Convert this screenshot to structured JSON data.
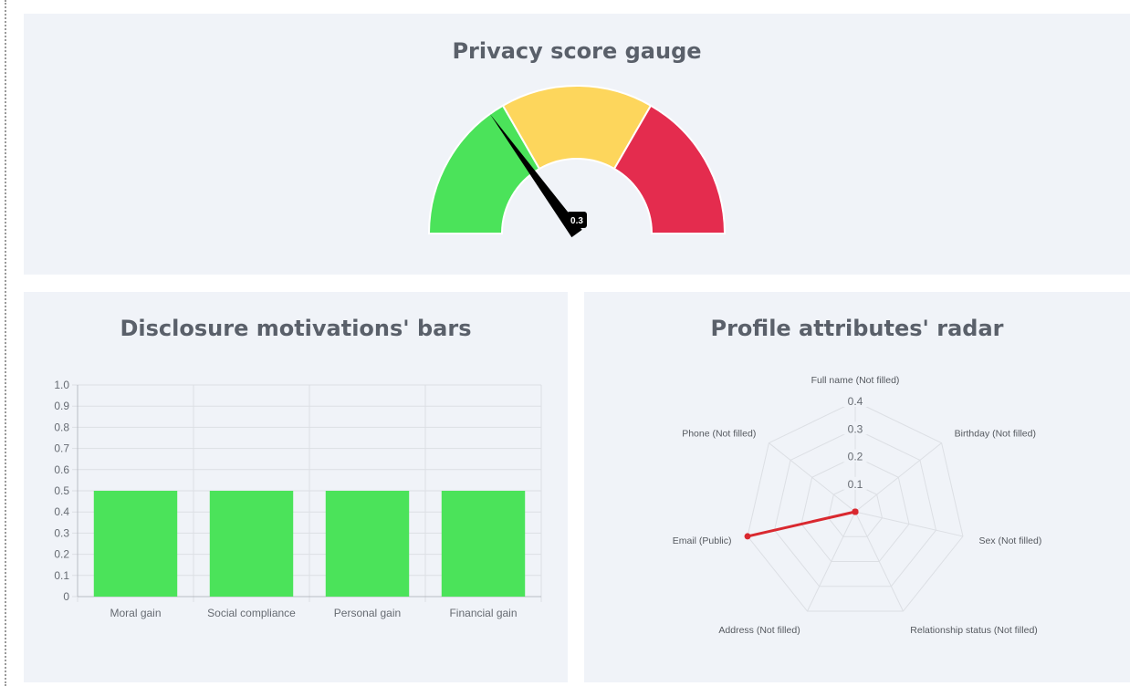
{
  "gauge": {
    "title": "Privacy score gauge",
    "value": 0.3,
    "value_label": "0.3",
    "range": [
      0,
      1
    ],
    "segments": [
      {
        "from": 0,
        "to": 0.3333,
        "color": "#4be35a"
      },
      {
        "from": 0.3333,
        "to": 0.6667,
        "color": "#fdd65c"
      },
      {
        "from": 0.6667,
        "to": 1,
        "color": "#e42c4e"
      }
    ]
  },
  "bars": {
    "title": "Disclosure motivations' bars",
    "bar_color": "#4be35a"
  },
  "radar": {
    "title": "Profile attributes' radar",
    "line_color": "#d9282f"
  },
  "chart_data": [
    {
      "type": "gauge",
      "title": "Privacy score gauge",
      "value": 0.3,
      "range": [
        0,
        1
      ],
      "bands": [
        "#4be35a",
        "#fdd65c",
        "#e42c4e"
      ]
    },
    {
      "type": "bar",
      "title": "Disclosure motivations' bars",
      "categories": [
        "Moral gain",
        "Social compliance",
        "Personal gain",
        "Financial gain"
      ],
      "values": [
        0.5,
        0.5,
        0.5,
        0.5
      ],
      "ylim": [
        0,
        1.0
      ],
      "yticks": [
        "0",
        "0.1",
        "0.2",
        "0.3",
        "0.4",
        "0.5",
        "0.6",
        "0.7",
        "0.8",
        "0.9",
        "1.0"
      ],
      "grid": true,
      "color": "#4be35a"
    },
    {
      "type": "radar",
      "title": "Profile attributes' radar",
      "axes": [
        "Full name (Not filled)",
        "Birthday (Not filled)",
        "Sex (Not filled)",
        "Relationship status (Not filled)",
        "Address (Not filled)",
        "Email (Public)",
        "Phone (Not filled)"
      ],
      "values": [
        0,
        0,
        0,
        0,
        0,
        0.4,
        0
      ],
      "rlim": [
        0,
        0.4
      ],
      "rticks": [
        "0.1",
        "0.2",
        "0.3",
        "0.4"
      ],
      "color": "#d9282f"
    }
  ]
}
